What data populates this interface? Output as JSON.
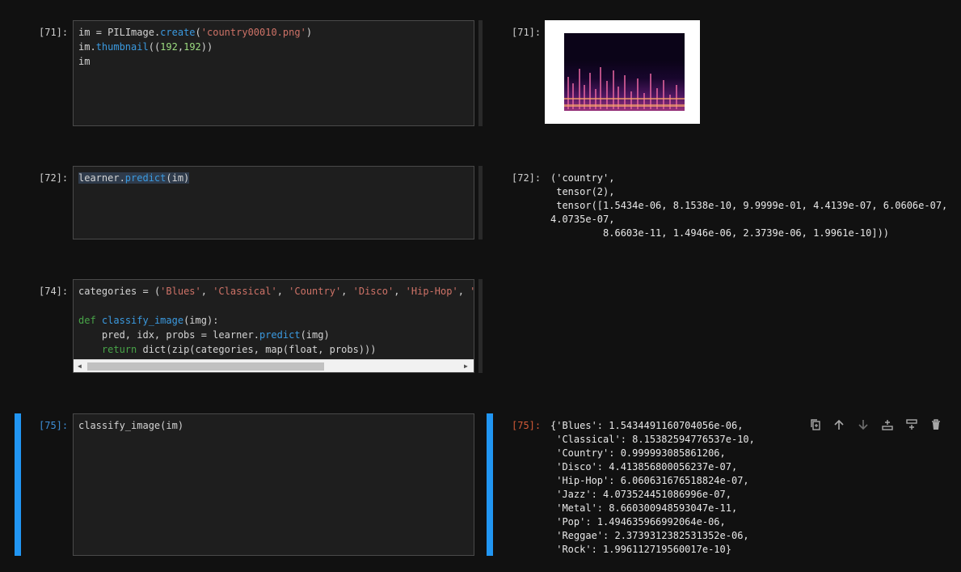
{
  "cells": [
    {
      "prompt_in": "[71]:",
      "prompt_out": "[71]:",
      "code": [
        "im = PILImage.create('country00010.png')",
        "im.thumbnail((192,192))",
        "im"
      ]
    },
    {
      "prompt_in": "[72]:",
      "prompt_out": "[72]:",
      "code": [
        "learner.predict(im)"
      ],
      "output": [
        "('country',",
        " tensor(2),",
        " tensor([1.5434e-06, 8.1538e-10, 9.9999e-01, 4.4139e-07, 6.0606e-07,",
        "4.0735e-07,",
        "         8.6603e-11, 1.4946e-06, 2.3739e-06, 1.9961e-10]))"
      ]
    },
    {
      "prompt_in": "[74]:",
      "code": [
        "categories = ('Blues', 'Classical', 'Country', 'Disco', 'Hip-Hop', '",
        "",
        "def classify_image(img):",
        "    pred, idx, probs = learner.predict(img)",
        "    return dict(zip(categories, map(float, probs)))"
      ]
    },
    {
      "prompt_in": "[75]:",
      "prompt_out": "[75]:",
      "code": [
        "classify_image(im)"
      ],
      "output": [
        "{'Blues': 1.5434491160704056e-06,",
        " 'Classical': 8.15382594776537e-10,",
        " 'Country': 0.999993085861206,",
        " 'Disco': 4.413856800056237e-07,",
        " 'Hip-Hop': 6.060631676518824e-07,",
        " 'Jazz': 4.073524451086996e-07,",
        " 'Metal': 8.660300948593047e-11,",
        " 'Pop': 1.494635966992064e-06,",
        " 'Reggae': 2.3739312382531352e-06,",
        " 'Rock': 1.996112719560017e-10}"
      ]
    }
  ],
  "toolbar": {
    "icons": [
      "copy-icon",
      "arrow-up-icon",
      "arrow-down-icon",
      "insert-above-icon",
      "insert-below-icon",
      "delete-icon"
    ]
  },
  "colors": {
    "background": "#111111",
    "active_bar": "#2196f3",
    "out_prompt_active": "#d35a37"
  }
}
